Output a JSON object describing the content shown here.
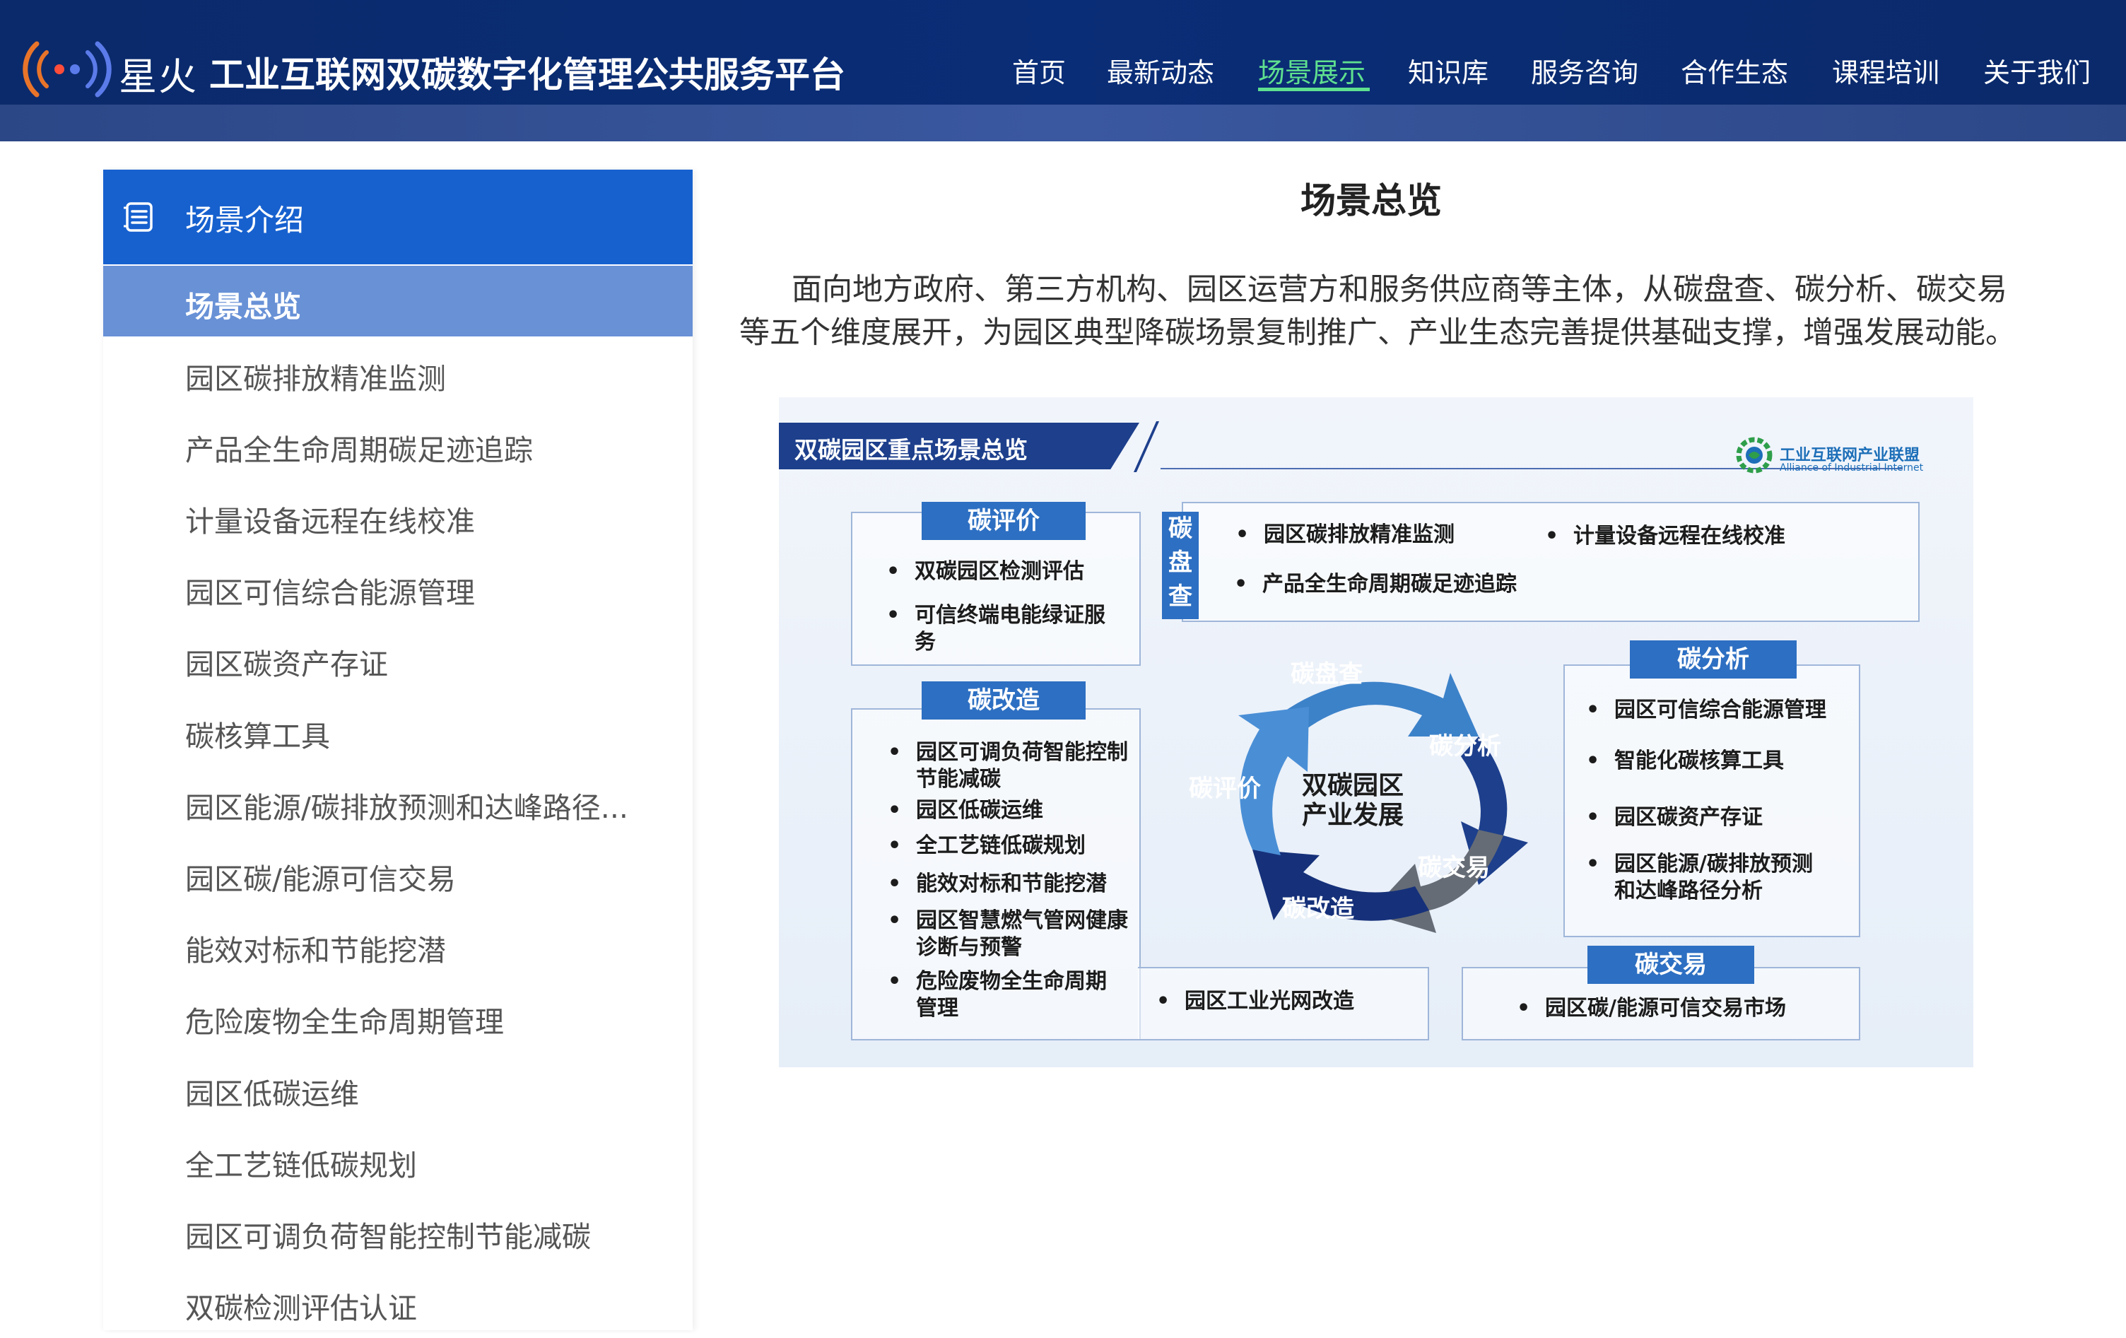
{
  "header": {
    "brand": "星火",
    "title": "工业互联网双碳数字化管理公共服务平台",
    "nav": [
      "首页",
      "最新动态",
      "场景展示",
      "知识库",
      "服务咨询",
      "合作生态",
      "课程培训",
      "关于我们"
    ],
    "active_nav": "场景展示"
  },
  "sidebar": {
    "title": "场景介绍",
    "items": [
      "场景总览",
      "园区碳排放精准监测",
      "产品全生命周期碳足迹追踪",
      "计量设备远程在线校准",
      "园区可信综合能源管理",
      "园区碳资产存证",
      "碳核算工具",
      "园区能源/碳排放预测和达峰路径...",
      "园区碳/能源可信交易",
      "能效对标和节能挖潜",
      "危险废物全生命周期管理",
      "园区低碳运维",
      "全工艺链低碳规划",
      "园区可调负荷智能控制节能减碳",
      "双碳检测评估认证"
    ],
    "active_item": "场景总览"
  },
  "main": {
    "title": "场景总览",
    "intro": "面向地方政府、第三方机构、园区运营方和服务供应商等主体，从碳盘查、碳分析、碳交易等五个维度展开，为园区典型降碳场景复制推广、产业生态完善提供基础支撑，增强发展动能。"
  },
  "diagram": {
    "title": "双碳园区重点场景总览",
    "alliance_name": "工业互联网产业联盟",
    "alliance_sub": "Alliance of Industrial Internet",
    "eval": {
      "tag": "碳评价",
      "items": [
        "双碳园区检测评估",
        "可信终端电能绿证服务"
      ]
    },
    "check": {
      "tag": "碳盘查",
      "items": [
        "园区碳排放精准监测",
        "计量设备远程在线校准",
        "产品全生命周期碳足迹追踪"
      ]
    },
    "reform": {
      "tag": "碳改造",
      "items": [
        "园区可调负荷智能控制节能减碳",
        "园区低碳运维",
        "全工艺链低碳规划",
        "能效对标和节能挖潜",
        "园区智慧燃气管网健康诊断与预警",
        "危险废物全生命周期管理"
      ]
    },
    "reform_extra": "园区工业光网改造",
    "analysis": {
      "tag": "碳分析",
      "items": [
        "园区可信综合能源管理",
        "智能化碳核算工具",
        "园区碳资产存证",
        "园区能源/碳排放预测和达峰路径分析"
      ]
    },
    "trade": {
      "tag": "碳交易",
      "items": [
        "园区碳/能源可信交易市场"
      ]
    },
    "cycle": {
      "center_line1": "双碳园区",
      "center_line2": "产业发展",
      "labels": [
        "碳盘查",
        "碳分析",
        "碳交易",
        "碳改造",
        "碳评价"
      ]
    }
  },
  "colors": {
    "header_bg": "#0b2a6b",
    "accent_green": "#5fe08f",
    "sidebar_header": "#1761cf",
    "sidebar_active": "#6891d6",
    "diagram_blue": "#2d6fc2"
  }
}
